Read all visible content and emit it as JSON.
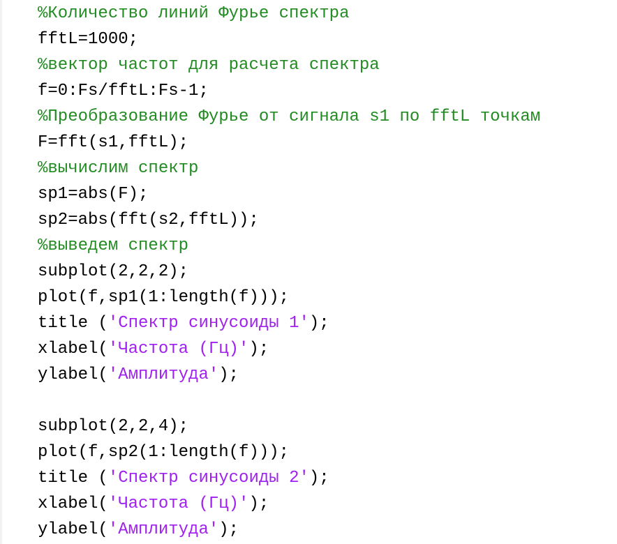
{
  "editor": {
    "colors": {
      "text": "#000000",
      "comment": "#228B22",
      "string": "#A020F0",
      "background": "#FFFFFF"
    },
    "lines": [
      [
        {
          "t": "comment",
          "s": "%Количество линий Фурье спектра"
        }
      ],
      [
        {
          "t": "plain",
          "s": "fftL=1000;"
        }
      ],
      [
        {
          "t": "comment",
          "s": "%вектор частот для расчета спектра"
        }
      ],
      [
        {
          "t": "plain",
          "s": "f=0:Fs/fftL:Fs-1;"
        }
      ],
      [
        {
          "t": "comment",
          "s": "%Преобразование Фурье от сигнала s1 по fftL точкам"
        }
      ],
      [
        {
          "t": "plain",
          "s": "F=fft(s1,fftL);"
        }
      ],
      [
        {
          "t": "comment",
          "s": "%вычислим спектр"
        }
      ],
      [
        {
          "t": "plain",
          "s": "sp1=abs(F);"
        }
      ],
      [
        {
          "t": "plain",
          "s": "sp2=abs(fft(s2,fftL));"
        }
      ],
      [
        {
          "t": "comment",
          "s": "%выведем спектр"
        }
      ],
      [
        {
          "t": "plain",
          "s": "subplot(2,2,2);"
        }
      ],
      [
        {
          "t": "plain",
          "s": "plot(f,sp1(1:length(f)));"
        }
      ],
      [
        {
          "t": "plain",
          "s": "title ("
        },
        {
          "t": "str",
          "s": "'Спектр синусоиды 1'"
        },
        {
          "t": "plain",
          "s": ");"
        }
      ],
      [
        {
          "t": "plain",
          "s": "xlabel("
        },
        {
          "t": "str",
          "s": "'Частота (Гц)'"
        },
        {
          "t": "plain",
          "s": ");"
        }
      ],
      [
        {
          "t": "plain",
          "s": "ylabel("
        },
        {
          "t": "str",
          "s": "'Амплитуда'"
        },
        {
          "t": "plain",
          "s": ");"
        }
      ],
      [],
      [
        {
          "t": "plain",
          "s": "subplot(2,2,4);"
        }
      ],
      [
        {
          "t": "plain",
          "s": "plot(f,sp2(1:length(f)));"
        }
      ],
      [
        {
          "t": "plain",
          "s": "title ("
        },
        {
          "t": "str",
          "s": "'Спектр синусоиды 2'"
        },
        {
          "t": "plain",
          "s": ");"
        }
      ],
      [
        {
          "t": "plain",
          "s": "xlabel("
        },
        {
          "t": "str",
          "s": "'Частота (Гц)'"
        },
        {
          "t": "plain",
          "s": ");"
        }
      ],
      [
        {
          "t": "plain",
          "s": "ylabel("
        },
        {
          "t": "str",
          "s": "'Амплитуда'"
        },
        {
          "t": "plain",
          "s": ");"
        }
      ]
    ]
  }
}
